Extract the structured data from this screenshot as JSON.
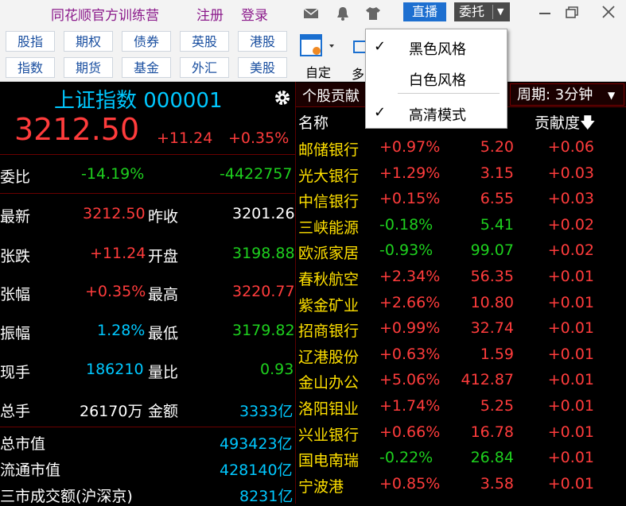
{
  "topbar": {
    "brand": "同花顺官方训练营",
    "register": "注册",
    "login": "登录",
    "live": "直播",
    "weituo": "委托"
  },
  "toolbar": {
    "row1": [
      "股指",
      "期权",
      "债券",
      "英股",
      "港股"
    ],
    "row2": [
      "指数",
      "期货",
      "基金",
      "外汇",
      "美股"
    ],
    "custom": "自定",
    "duo": "多"
  },
  "index": {
    "name": "上证指数 000001",
    "price": "3212.50",
    "change": "+11.24",
    "pct": "+0.35%"
  },
  "stats": {
    "weibi_label": "委比",
    "weibi_pct": "-14.19%",
    "weibi_val": "-4422757",
    "rows": [
      {
        "l1": "最新",
        "v1": "3212.50",
        "l2": "昨收",
        "v2": "3201.26"
      },
      {
        "l1": "张跌",
        "v1": "+11.24",
        "l2": "开盘",
        "v2": "3198.88"
      },
      {
        "l1": "张幅",
        "v1": "+0.35%",
        "l2": "最高",
        "v2": "3220.77"
      },
      {
        "l1": "振幅",
        "v1": "1.28%",
        "l2": "最低",
        "v2": "3179.82"
      },
      {
        "l1": "现手",
        "v1": "186210",
        "l2": "量比",
        "v2": "0.93"
      },
      {
        "l1": "总手",
        "v1": "26170万",
        "l2": "金额",
        "v2": "3333亿"
      }
    ],
    "bottom": [
      {
        "l": "总市值",
        "v": "493423亿"
      },
      {
        "l": "流通市值",
        "v": "428140亿"
      },
      {
        "l": "三市成交额(沪深京)",
        "v": "8231亿"
      }
    ]
  },
  "right": {
    "title": "个股贡献",
    "period": "周期: 3分钟",
    "col_name": "名称",
    "col_contrib": "贡献度"
  },
  "stocks": [
    {
      "name": "邮储银行",
      "pct": "+0.97%",
      "price": "5.20",
      "contrib": "+0.06",
      "dir": "up"
    },
    {
      "name": "光大银行",
      "pct": "+1.29%",
      "price": "3.15",
      "contrib": "+0.03",
      "dir": "up"
    },
    {
      "name": "中信银行",
      "pct": "+0.15%",
      "price": "6.55",
      "contrib": "+0.03",
      "dir": "up"
    },
    {
      "name": "三峡能源",
      "pct": "-0.18%",
      "price": "5.41",
      "contrib": "+0.02",
      "dir": "down"
    },
    {
      "name": "欧派家居",
      "pct": "-0.93%",
      "price": "99.07",
      "contrib": "+0.02",
      "dir": "down"
    },
    {
      "name": "春秋航空",
      "pct": "+2.34%",
      "price": "56.35",
      "contrib": "+0.01",
      "dir": "up"
    },
    {
      "name": "紫金矿业",
      "pct": "+2.66%",
      "price": "10.80",
      "contrib": "+0.01",
      "dir": "up"
    },
    {
      "name": "招商银行",
      "pct": "+0.99%",
      "price": "32.74",
      "contrib": "+0.01",
      "dir": "up"
    },
    {
      "name": "辽港股份",
      "pct": "+0.63%",
      "price": "1.59",
      "contrib": "+0.01",
      "dir": "up"
    },
    {
      "name": "金山办公",
      "pct": "+5.06%",
      "price": "412.87",
      "contrib": "+0.01",
      "dir": "up"
    },
    {
      "name": "洛阳钼业",
      "pct": "+1.74%",
      "price": "5.25",
      "contrib": "+0.01",
      "dir": "up"
    },
    {
      "name": "兴业银行",
      "pct": "+0.66%",
      "price": "16.78",
      "contrib": "+0.01",
      "dir": "up"
    },
    {
      "name": "国电南瑞",
      "pct": "-0.22%",
      "price": "26.84",
      "contrib": "+0.01",
      "dir": "down"
    },
    {
      "name": "宁波港",
      "pct": "+0.85%",
      "price": "3.58",
      "contrib": "+0.01",
      "dir": "up"
    }
  ],
  "menu": {
    "items": [
      "黑色风格",
      "白色风格",
      "高清模式"
    ],
    "check": "✓"
  },
  "colors": {
    "up": "#ff3c3c",
    "down": "#1ed01e",
    "cyan": "#00c8ff"
  }
}
